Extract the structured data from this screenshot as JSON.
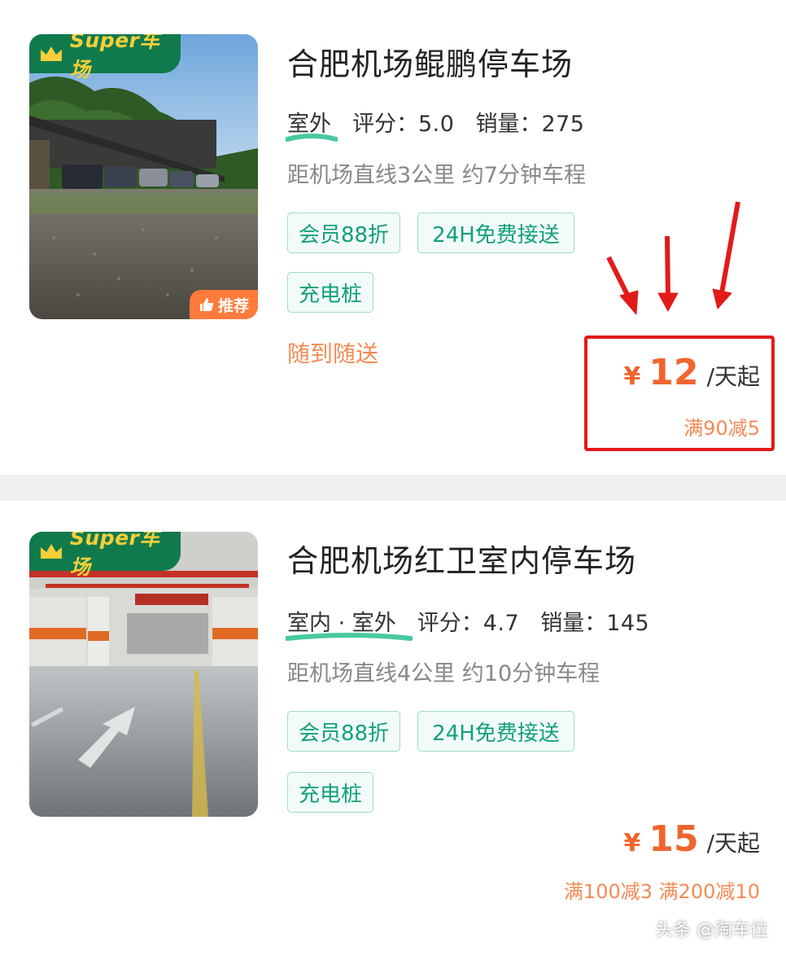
{
  "listings": [
    {
      "badge": "Super车场",
      "recommend_label": "推荐",
      "title": "合肥机场鲲鹏停车场",
      "environment": "室外",
      "rating_label": "评分：",
      "rating": "5.0",
      "sales_label": "销量：",
      "sales": "275",
      "distance": "距机场直线3公里 约7分钟车程",
      "tags": [
        "会员88折",
        "24H免费接送",
        "充电桩"
      ],
      "service_note": "随到随送",
      "price_symbol": "¥",
      "price": "12",
      "price_unit": "/天起",
      "discount": "满90减5"
    },
    {
      "badge": "Super车场",
      "title": "合肥机场红卫室内停车场",
      "environment": "室内 · 室外",
      "rating_label": "评分：",
      "rating": "4.7",
      "sales_label": "销量：",
      "sales": "145",
      "distance": "距机场直线4公里 约10分钟车程",
      "tags": [
        "会员88折",
        "24H免费接送",
        "充电桩"
      ],
      "price_symbol": "¥",
      "price": "15",
      "price_unit": "/天起",
      "discount": "满100减3 满200减10"
    }
  ],
  "watermark": "头条 @淘车位",
  "colors": {
    "accent_orange": "#f0662e",
    "tag_green": "#12a07a",
    "badge_green": "#117a4d",
    "highlight_red": "#e31a1a"
  }
}
